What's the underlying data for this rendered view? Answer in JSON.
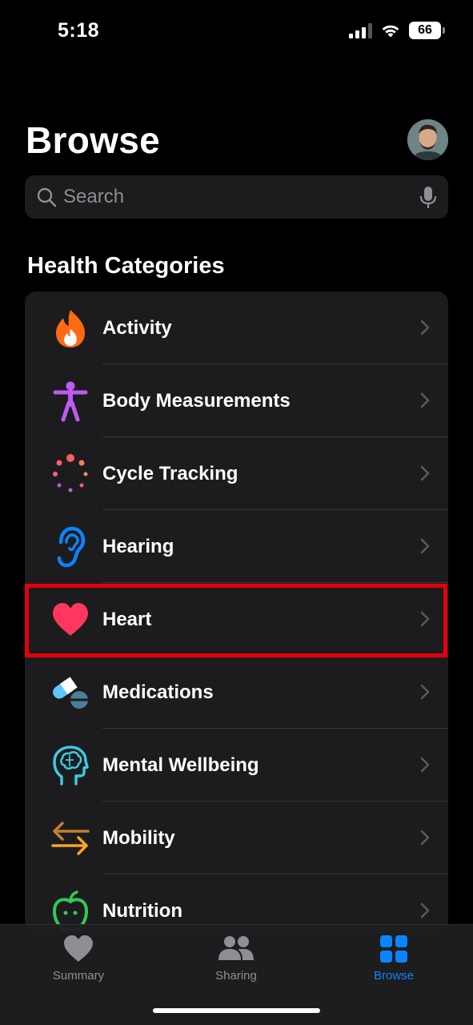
{
  "status_bar": {
    "time": "5:18",
    "battery": "66"
  },
  "header": {
    "title": "Browse"
  },
  "search": {
    "placeholder": "Search"
  },
  "section": {
    "title": "Health Categories"
  },
  "categories": [
    {
      "label": "Activity",
      "icon": "flame-icon",
      "color": "#ff6a13"
    },
    {
      "label": "Body Measurements",
      "icon": "person-figure-icon",
      "color": "#bf5af2"
    },
    {
      "label": "Cycle Tracking",
      "icon": "cycle-tracking-icon",
      "color": "#ff5e62"
    },
    {
      "label": "Hearing",
      "icon": "ear-icon",
      "color": "#0a84ff"
    },
    {
      "label": "Heart",
      "icon": "heart-icon",
      "color": "#ff375f"
    },
    {
      "label": "Medications",
      "icon": "pills-icon",
      "color": "#5ac8fa"
    },
    {
      "label": "Mental Wellbeing",
      "icon": "brain-head-icon",
      "color": "#40c8e0"
    },
    {
      "label": "Mobility",
      "icon": "arrows-icon",
      "color": "#f5a623"
    },
    {
      "label": "Nutrition",
      "icon": "apple-icon",
      "color": "#34c759"
    }
  ],
  "tab_bar": {
    "tabs": [
      {
        "label": "Summary",
        "icon": "heart-icon",
        "active": false
      },
      {
        "label": "Sharing",
        "icon": "people-icon",
        "active": false
      },
      {
        "label": "Browse",
        "icon": "grid-icon",
        "active": true
      }
    ]
  },
  "colors": {
    "accent": "#0a84ff",
    "highlight_border": "#e3000f",
    "background": "#000000",
    "card": "#1c1c1e"
  }
}
